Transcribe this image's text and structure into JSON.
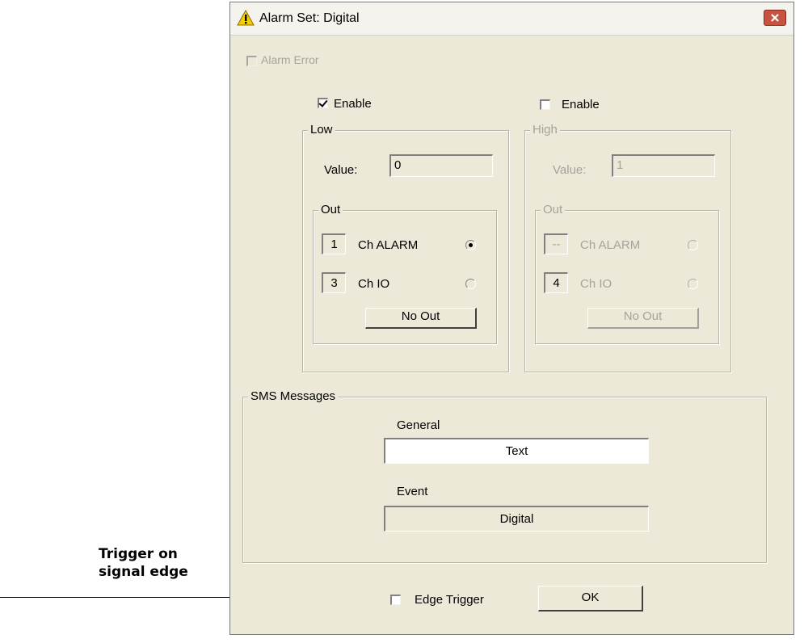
{
  "window": {
    "title": "Alarm Set: Digital",
    "icons": {
      "title": "warning-icon",
      "close": "close-icon"
    }
  },
  "alarm_error": {
    "label": "Alarm Error",
    "checked": false,
    "enabled": false
  },
  "low": {
    "group_label": "Low",
    "enable_label": "Enable",
    "enable_checked": true,
    "value_label": "Value:",
    "value": "0",
    "out": {
      "group_label": "Out",
      "ch_alarm_num": "1",
      "ch_alarm_label": "Ch ALARM",
      "ch_io_num": "3",
      "ch_io_label": "Ch IO",
      "selected": "Ch ALARM",
      "no_out_label": "No Out"
    }
  },
  "high": {
    "group_label": "High",
    "enable_label": "Enable",
    "enable_checked": false,
    "value_label": "Value:",
    "value": "1",
    "out": {
      "group_label": "Out",
      "ch_alarm_num": "--",
      "ch_alarm_label": "Ch ALARM",
      "ch_io_num": "4",
      "ch_io_label": "Ch IO",
      "selected": "none",
      "no_out_label": "No Out"
    }
  },
  "sms": {
    "group_label": "SMS Messages",
    "general_label": "General",
    "general_value": "Text",
    "event_label": "Event",
    "event_value": "Digital"
  },
  "footer": {
    "edge_trigger_label": "Edge Trigger",
    "edge_trigger_checked": false,
    "ok_label": "OK"
  },
  "annotation": {
    "line1": "Trigger on",
    "line2": "signal edge"
  },
  "colors": {
    "dialog_bg": "#ece9d8",
    "close_button": "#c7523f",
    "warning": "#f5d000"
  }
}
